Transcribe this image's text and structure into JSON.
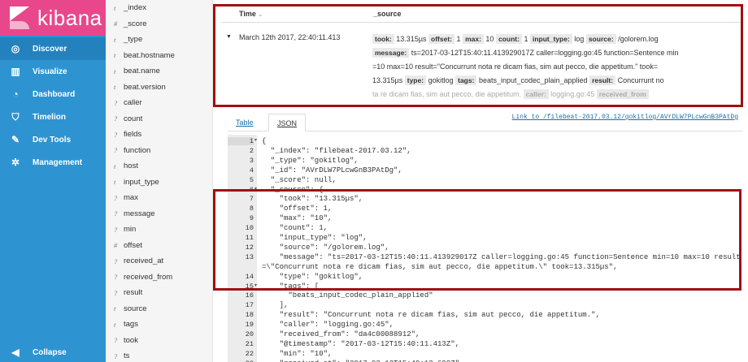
{
  "app": {
    "name": "kibana"
  },
  "nav": {
    "items": [
      {
        "label": "Discover",
        "icon": "compass-icon",
        "glyph": "◎"
      },
      {
        "label": "Visualize",
        "icon": "bar-chart-icon",
        "glyph": "▥"
      },
      {
        "label": "Dashboard",
        "icon": "dashboard-icon",
        "glyph": "◔"
      },
      {
        "label": "Timelion",
        "icon": "shield-icon",
        "glyph": "⛉"
      },
      {
        "label": "Dev Tools",
        "icon": "wrench-icon",
        "glyph": "✎"
      },
      {
        "label": "Management",
        "icon": "gear-icon",
        "glyph": "✲"
      }
    ],
    "collapse": {
      "label": "Collapse",
      "glyph": "◀"
    }
  },
  "fields": [
    {
      "type": "t",
      "name": "_index"
    },
    {
      "type": "#",
      "name": "_score"
    },
    {
      "type": "t",
      "name": "_type"
    },
    {
      "type": "t",
      "name": "beat.hostname"
    },
    {
      "type": "t",
      "name": "beat.name"
    },
    {
      "type": "t",
      "name": "beat.version"
    },
    {
      "type": "?",
      "name": "caller"
    },
    {
      "type": "?",
      "name": "count"
    },
    {
      "type": "?",
      "name": "fields"
    },
    {
      "type": "?",
      "name": "function"
    },
    {
      "type": "t",
      "name": "host"
    },
    {
      "type": "t",
      "name": "input_type"
    },
    {
      "type": "?",
      "name": "max"
    },
    {
      "type": "?",
      "name": "message"
    },
    {
      "type": "?",
      "name": "min"
    },
    {
      "type": "#",
      "name": "offset"
    },
    {
      "type": "?",
      "name": "received_at"
    },
    {
      "type": "?",
      "name": "received_from"
    },
    {
      "type": "?",
      "name": "result"
    },
    {
      "type": "t",
      "name": "source"
    },
    {
      "type": "t",
      "name": "tags"
    },
    {
      "type": "?",
      "name": "took"
    },
    {
      "type": "?",
      "name": "ts"
    }
  ],
  "table": {
    "time_header": "Time",
    "time_sort_glyph": "⌄",
    "source_header": "_source",
    "row": {
      "caret": "▼",
      "timestamp": "March 12th 2017, 22:40:11.413",
      "summary_lines": [
        [
          {
            "k": "took:"
          },
          {
            "v": "13.315µs"
          },
          {
            "k": "offset:"
          },
          {
            "v": "1"
          },
          {
            "k": "max:"
          },
          {
            "v": "10"
          },
          {
            "k": "count:"
          },
          {
            "v": "1"
          },
          {
            "k": "input_type:"
          },
          {
            "v": "log"
          },
          {
            "k": "source:"
          },
          {
            "v": "/golorem.log"
          }
        ],
        [
          {
            "k": "message:"
          },
          {
            "v": "ts=2017-03-12T15:40:11.413929017Z caller=logging.go:45 function=Sentence min"
          }
        ],
        [
          {
            "v": "=10 max=10 result=\"Concurrunt nota re dicam fias, sim aut pecco, die appetitum.\" took="
          }
        ],
        [
          {
            "v": "13.315µs"
          },
          {
            "k": "type:"
          },
          {
            "v": "gokitlog"
          },
          {
            "k": "tags:"
          },
          {
            "v": "beats_input_codec_plain_applied"
          },
          {
            "k": "result:"
          },
          {
            "v": "Concurrunt no"
          }
        ],
        [
          {
            "v": "ta re dicam fias, sim aut pecco, die appetitum."
          },
          {
            "k": "caller:"
          },
          {
            "v": "logging.go:45"
          },
          {
            "k": "received_from"
          }
        ]
      ]
    }
  },
  "tabs": {
    "table": "Table",
    "json": "JSON",
    "doc_link": "Link to /filebeat-2017.03.12/gokitlog/AVrDLW7PLcwGnB3PAtDg"
  },
  "json_lines": [
    {
      "n": "1",
      "fold": "▾",
      "text": "{"
    },
    {
      "n": "2",
      "text": "  \"_index\": \"filebeat-2017.03.12\","
    },
    {
      "n": "3",
      "text": "  \"_type\": \"gokitlog\","
    },
    {
      "n": "4",
      "text": "  \"_id\": \"AVrDLW7PLcwGnB3PAtDg\","
    },
    {
      "n": "5",
      "text": "  \"_score\": null,"
    },
    {
      "n": "6",
      "fold": "▾",
      "text": "  \"_source\": {"
    },
    {
      "n": "7",
      "text": "    \"took\": \"13.315µs\","
    },
    {
      "n": "8",
      "text": "    \"offset\": 1,"
    },
    {
      "n": "9",
      "text": "    \"max\": \"10\","
    },
    {
      "n": "10",
      "text": "    \"count\": 1,"
    },
    {
      "n": "11",
      "text": "    \"input_type\": \"log\","
    },
    {
      "n": "12",
      "text": "    \"source\": \"/golorem.log\","
    },
    {
      "n": "13",
      "text": "    \"message\": \"ts=2017-03-12T15:40:11.413929017Z caller=logging.go:45 function=Sentence min=10 max=10 result"
    },
    {
      "n": "",
      "text": "=\\\"Concurrunt nota re dicam fias, sim aut pecco, die appetitum.\\\" took=13.315µs\","
    },
    {
      "n": "14",
      "text": "    \"type\": \"gokitlog\","
    },
    {
      "n": "15",
      "fold": "▾",
      "text": "    \"tags\": ["
    },
    {
      "n": "16",
      "text": "      \"beats_input_codec_plain_applied\""
    },
    {
      "n": "17",
      "text": "    ],"
    },
    {
      "n": "18",
      "text": "    \"result\": \"Concurrunt nota re dicam fias, sim aut pecco, die appetitum.\","
    },
    {
      "n": "19",
      "text": "    \"caller\": \"logging.go:45\","
    },
    {
      "n": "20",
      "text": "    \"received_from\": \"da4c00088912\","
    },
    {
      "n": "21",
      "text": "    \"@timestamp\": \"2017-03-12T15:40:11.413Z\","
    },
    {
      "n": "22",
      "text": "    \"min\": \"10\","
    },
    {
      "n": "23",
      "text": "    \"received_at\": \"2017-03-12T15:40:12.699Z\","
    }
  ],
  "colors": {
    "nav_bg": "#2e94d1",
    "logo_bg": "#e8488b",
    "highlight_box": "#a10f12"
  }
}
